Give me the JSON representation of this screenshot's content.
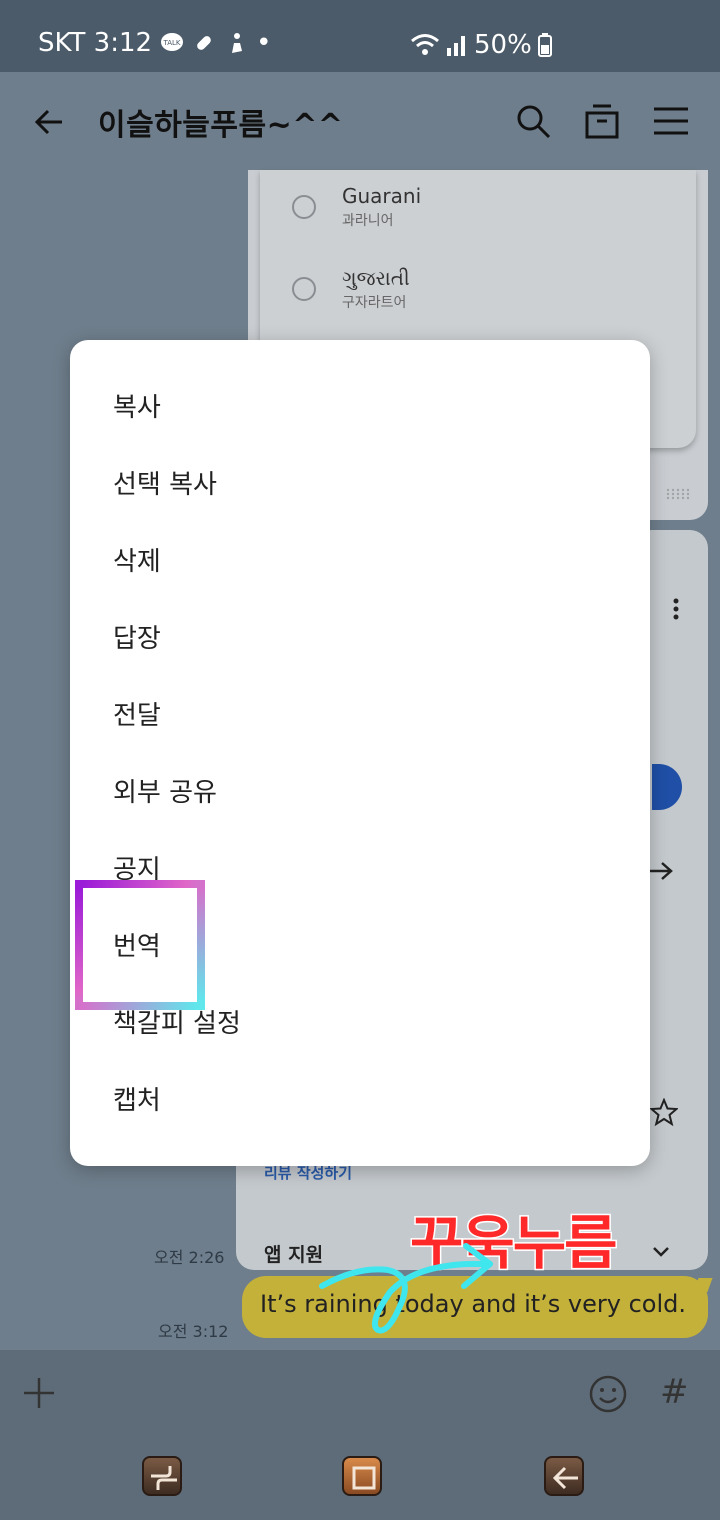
{
  "status_bar": {
    "carrier_time": "SKT 3:12",
    "dot": "•",
    "battery": "50%"
  },
  "app_bar": {
    "title": "이슬하늘푸름~^^"
  },
  "language_list": [
    {
      "name": "Guarani",
      "sub": "과라니어"
    },
    {
      "name": "ગુજરાતી",
      "sub": "구자라트어"
    }
  ],
  "share_card": {
    "review_link": "리뷰 작성하기",
    "app_support": "앱 지원"
  },
  "messages": {
    "time1": "오전 2:26",
    "time2": "오전 3:12",
    "bubble_text": "It’s raining today and it’s very cold."
  },
  "annotation": {
    "press_label": "꾸욱누름"
  },
  "context_menu": {
    "items": [
      "복사",
      "선택 복사",
      "삭제",
      "답장",
      "전달",
      "외부 공유",
      "공지",
      "번역",
      "책갈피 설정",
      "캡처"
    ],
    "highlighted_item": "번역"
  },
  "input_bar": {
    "hash": "#"
  },
  "icons": {
    "back": "arrow-left-icon",
    "search": "search-icon",
    "drawer": "drawer-icon",
    "menu": "hamburger-menu-icon",
    "plus": "plus-icon",
    "emoji": "emoji-icon"
  },
  "colors": {
    "highlight_gradient_start": "#9a1bd8",
    "highlight_gradient_end": "#5ee8ec",
    "press_label": "#ff2929",
    "bubble": "#c4b13a"
  }
}
